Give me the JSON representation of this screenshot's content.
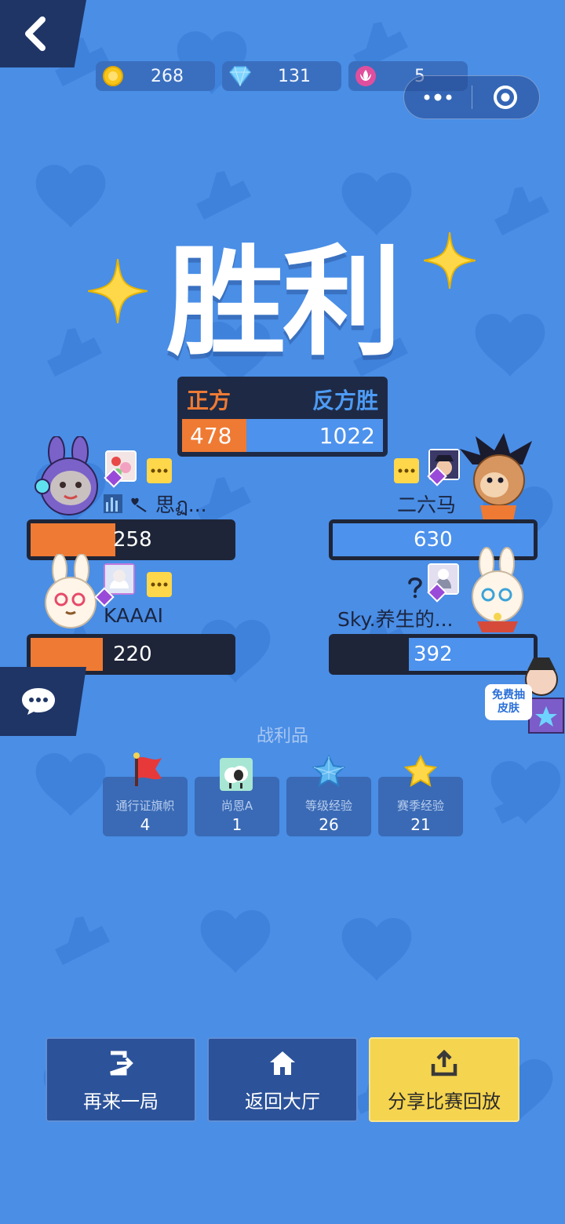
{
  "currency": [
    {
      "icon": "coin-icon",
      "value": "268"
    },
    {
      "icon": "diamond-icon",
      "value": "131"
    },
    {
      "icon": "lotus-icon",
      "value": "5"
    }
  ],
  "title": "胜利",
  "score": {
    "left_label": "正方",
    "right_label": "反方胜",
    "left_value": "478",
    "right_value": "1022",
    "left_fraction": 0.319
  },
  "players": {
    "left": [
      {
        "name": "思ฏ...",
        "score": "258",
        "fraction": 0.42
      },
      {
        "name": "KAAAI",
        "score": "220",
        "fraction": 0.36
      }
    ],
    "right": [
      {
        "name": "二六马",
        "score": "630",
        "fraction": 1.0
      },
      {
        "name": "Sky.养生的...",
        "score": "392",
        "fraction": 0.62
      }
    ]
  },
  "free_skin": {
    "line1": "免费抽",
    "line2": "皮肤"
  },
  "loot": {
    "title": "战利品",
    "items": [
      {
        "icon": "flag-icon",
        "name": "通行证旗帜",
        "count": "4"
      },
      {
        "icon": "sheep-icon",
        "name": "尚恩A",
        "count": "1"
      },
      {
        "icon": "star-gem-icon",
        "name": "等级经验",
        "count": "26"
      },
      {
        "icon": "star-icon",
        "name": "赛季经验",
        "count": "21"
      }
    ]
  },
  "buttons": {
    "again": "再来一局",
    "lobby": "返回大厅",
    "share": "分享比赛回放"
  },
  "colors": {
    "background": "#4a8ee6",
    "orange_team": "#ef7a33",
    "blue_team": "#4d92ec",
    "dark": "#1e2538",
    "share_button": "#f5d44f"
  }
}
